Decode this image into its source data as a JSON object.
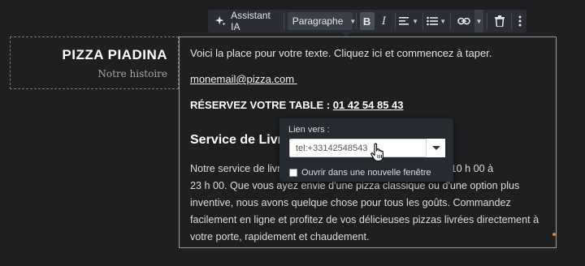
{
  "toolbar": {
    "assistant_label": "Assistant IA",
    "paragraph_label": "Paragraphe",
    "bold_label": "B",
    "italic_label": "I",
    "icons": [
      "sparkle-icon",
      "align-left-icon",
      "bullet-list-icon",
      "link-icon",
      "trash-icon",
      "more-vertical-icon"
    ]
  },
  "site": {
    "brand": "PIZZA PIADINA",
    "tagline": "Notre histoire"
  },
  "editor": {
    "intro": "Voici la place pour votre texte. Cliquez ici et commencez à taper.",
    "email": "monemail@pizza.com ",
    "reserve_prefix": "RÉSERVEZ VOTRE TABLE : ",
    "phone": "01 42 54 85 43",
    "heading": "Service de Livraison",
    "body_lines": [
      "Notre service de livraison est disponible tous les jours de 10 h 00 à",
      "23 h 00. Que vous ayez envie d'une pizza classique ou d'une option plus",
      "inventive, nous avons quelque chose pour tous les goûts. Commandez",
      "facilement en ligne et profitez de vos délicieuses pizzas livrées directement à",
      "votre porte, rapidement et chaudement."
    ]
  },
  "link_popover": {
    "label": "Lien vers :",
    "value": "tel:+33142548543",
    "new_window_label": "Ouvrir dans une nouvelle fenêtre"
  },
  "colors": {
    "background": "#1f1f22",
    "toolbar": "#2a2d35",
    "accent_dot": "#e87f2c"
  }
}
